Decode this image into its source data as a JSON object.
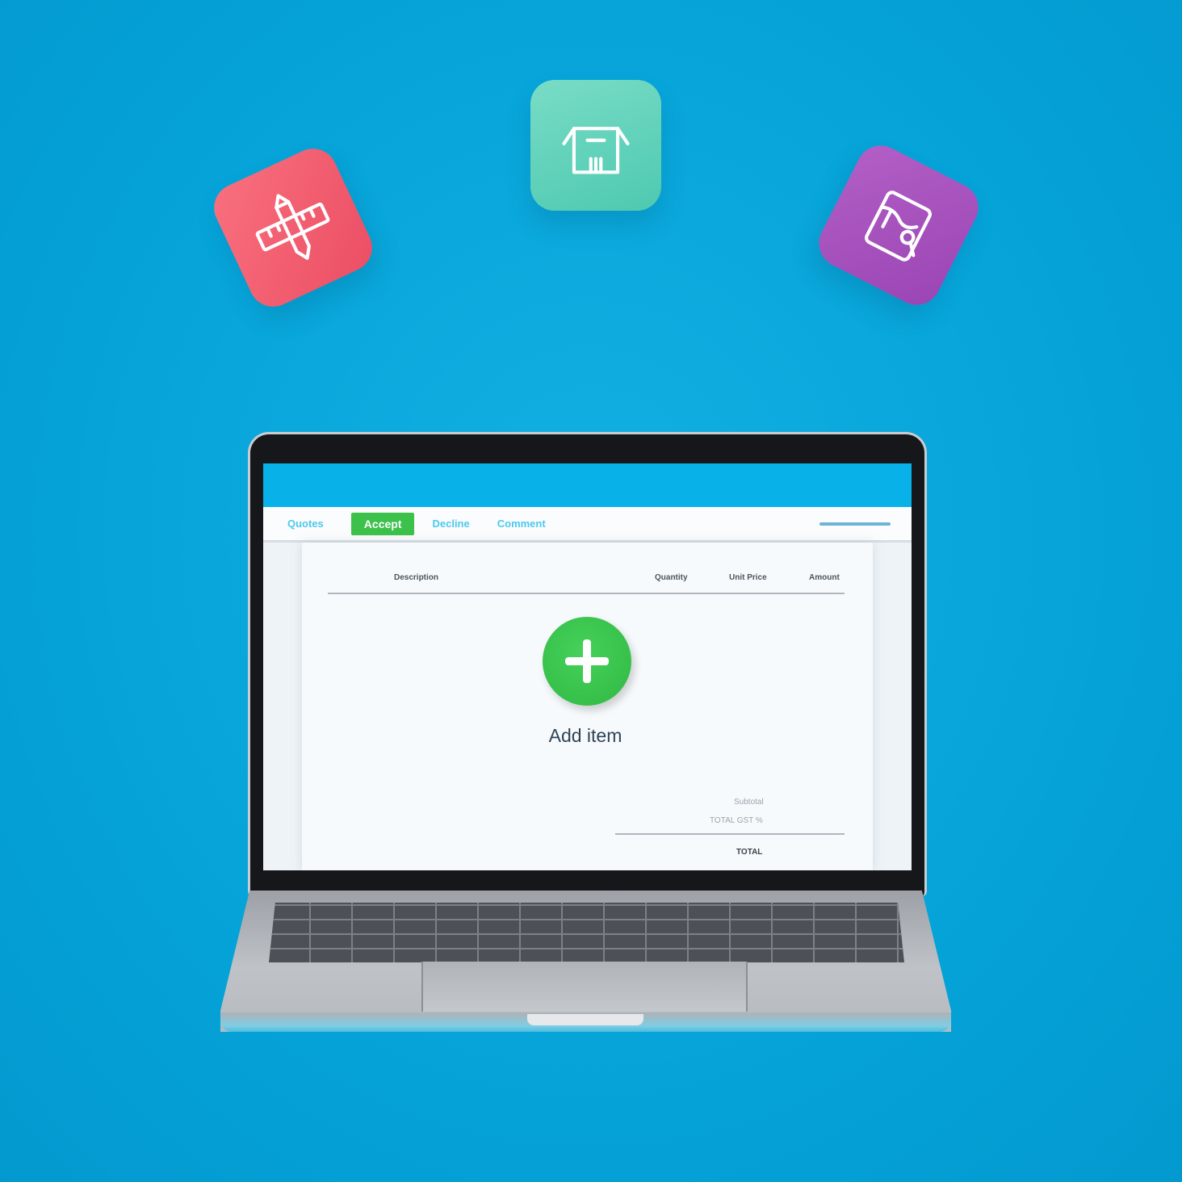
{
  "colors": {
    "background": "#05a3d8",
    "screen_header": "#08b2e8",
    "accept_green": "#3cc14b",
    "add_button_green": "#35be49",
    "tile_red": "#f26075",
    "tile_green": "#5ed1b9",
    "tile_purple": "#a650bc"
  },
  "floating_icons": [
    {
      "name": "design-tools-icon",
      "tile_color": "#f26075"
    },
    {
      "name": "open-box-icon",
      "tile_color": "#5ed1b9"
    },
    {
      "name": "paint-bucket-icon",
      "tile_color": "#a650bc"
    }
  ],
  "toolbar": {
    "tabs": [
      {
        "label": "Quotes"
      },
      {
        "label": "Accept"
      },
      {
        "label": "Decline"
      },
      {
        "label": "Comment"
      }
    ]
  },
  "table": {
    "columns": [
      "Description",
      "Quantity",
      "Unit Price",
      "Amount"
    ]
  },
  "add_item": {
    "icon": "plus-icon",
    "label": "Add item"
  },
  "summary": {
    "subtotal_label": "Subtotal",
    "gst_label": "TOTAL GST %",
    "total_label": "TOTAL"
  }
}
